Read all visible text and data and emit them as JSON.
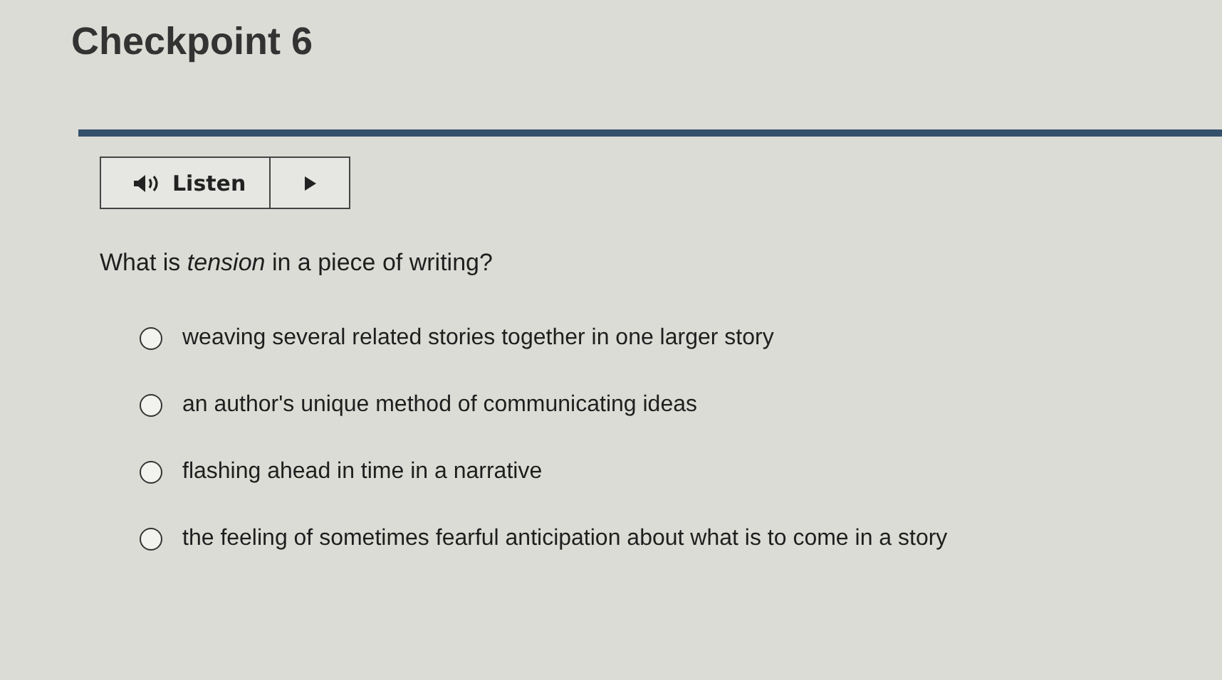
{
  "title": "Checkpoint 6",
  "listen": {
    "label": "Listen"
  },
  "question": "What is *tension* in a piece of writing?",
  "options": [
    {
      "label": "weaving several related stories together in one larger story",
      "selected": false
    },
    {
      "label": "an author's unique method of communicating ideas",
      "selected": false
    },
    {
      "label": "flashing ahead in time in a narrative",
      "selected": false
    },
    {
      "label": "the feeling of sometimes fearful anticipation about what is to come in a story",
      "selected": false
    }
  ]
}
